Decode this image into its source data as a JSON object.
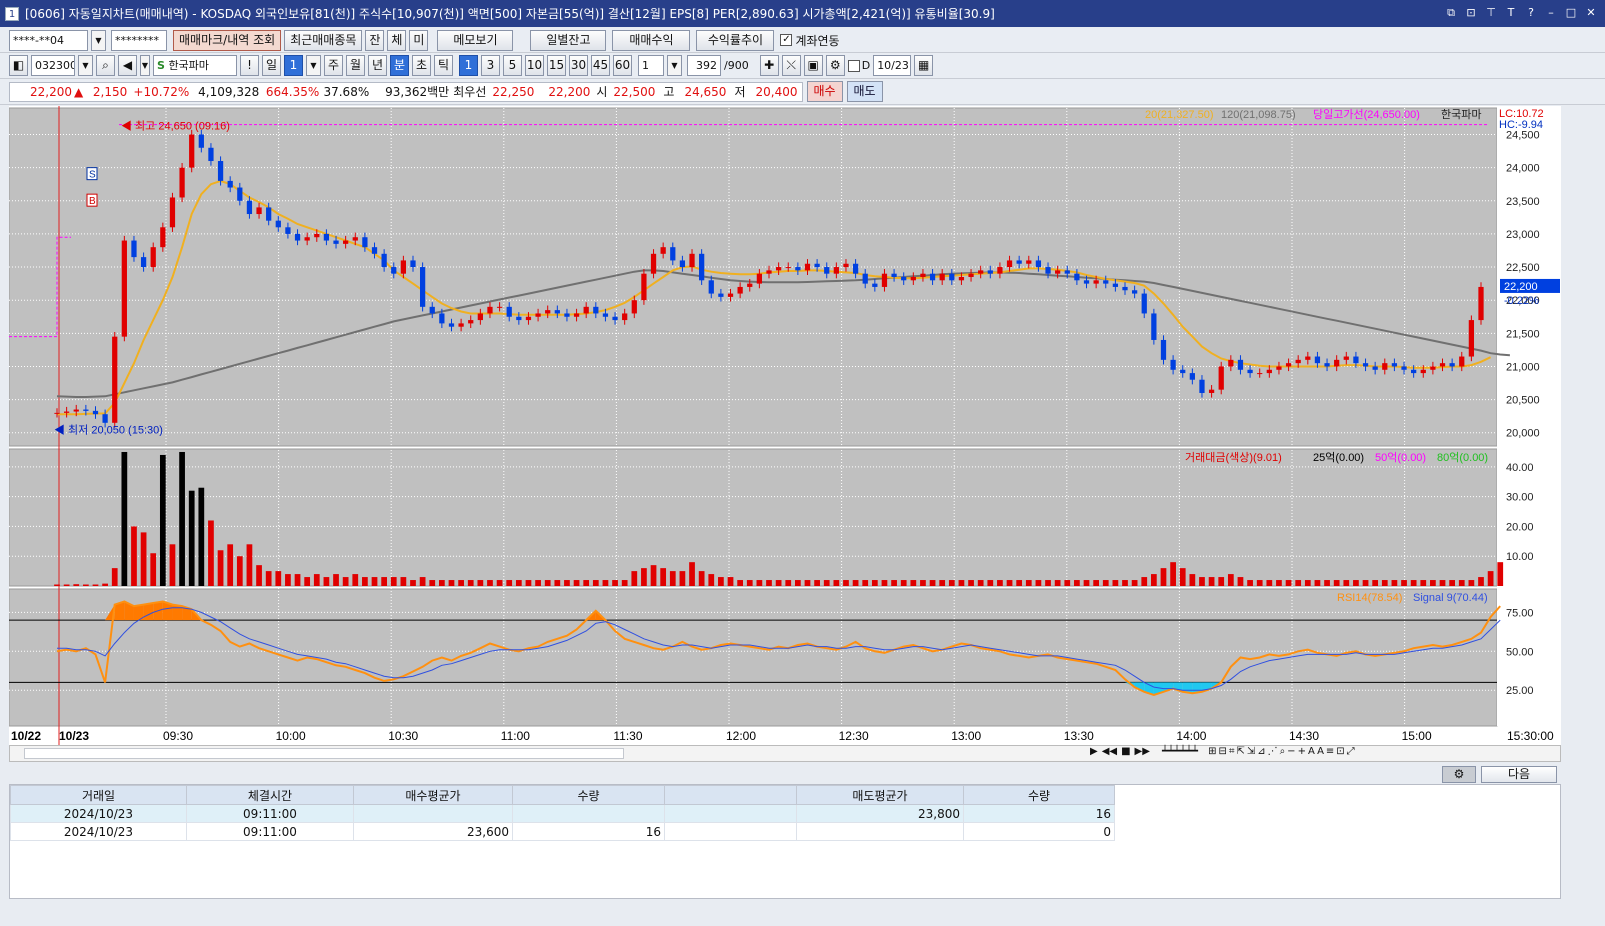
{
  "window": {
    "title": "[0606] 자동일지차트(매매내역) - KOSDAQ 외국인보유[81(천)] 주식수[10,907(천)] 액면[500] 자본금[55(억)] 결산[12월] EPS[8] PER[2,890.63] 시가총액[2,421(억)] 유통비율[30.9]",
    "icon_label": "1"
  },
  "toolbar1": {
    "account": "****-**04",
    "password": "********",
    "btn_trade_mark": "매매마크/내역 조회",
    "btn_recent": "최근매매종목",
    "btn_jan": "잔",
    "btn_che": "체",
    "btn_mi": "미",
    "btn_memo": "메모보기",
    "btn_daily_balance": "일별잔고",
    "btn_profit": "매매수익",
    "btn_yield": "수익률추이",
    "chk_link": "계좌연동"
  },
  "toolbar2": {
    "code": "032300",
    "stock_name": "한국파마",
    "exclaim": "!",
    "period_day": "일",
    "period_num": "1",
    "week": "주",
    "month": "월",
    "year": "년",
    "minute": "분",
    "second": "초",
    "tick": "틱",
    "intervals": [
      "1",
      "3",
      "5",
      "10",
      "15",
      "30",
      "45",
      "60"
    ],
    "interval_input": "1",
    "count": "392",
    "count_max": "/900",
    "d_label": "D",
    "date": "10/23"
  },
  "pricebar": {
    "price": "22,200",
    "arrow": "▲",
    "change": "2,150",
    "change_pct": "+10.72%",
    "volume": "4,109,328",
    "vol_ratio": "664.35%",
    "turnover": "37.68%",
    "amount": "93,362백만",
    "best_ask_label": "최우선",
    "ask": "22,250",
    "bid": "22,200",
    "open_label": "시",
    "open": "22,500",
    "high_label": "고",
    "high": "24,650",
    "low_label": "저",
    "low": "20,400",
    "buy": "매수",
    "sell": "매도"
  },
  "chart_data": {
    "type": "candlestick",
    "stock": "한국파마",
    "x_ticks": [
      "10/22",
      "10/23",
      "09:30",
      "10:00",
      "10:30",
      "11:00",
      "11:30",
      "12:00",
      "12:30",
      "13:00",
      "13:30",
      "14:00",
      "14:30",
      "15:00",
      "15:30:00"
    ],
    "price_axis": [
      "24,500",
      "24,000",
      "23,500",
      "23,000",
      "22,500",
      "22,000",
      "21,500",
      "21,000",
      "20,500",
      "20,000"
    ],
    "ylim": [
      19800,
      24900
    ],
    "legend": {
      "ma20": "20(21,327.50)",
      "ma120": "120(21,098.75)",
      "high_line": "당일고가선(24,650.00)",
      "name": "한국파마",
      "lc": "LC:10.72",
      "hc": "HC:-9.94"
    },
    "current_price": "22,200",
    "current_pct": "-0.22%",
    "annotations": {
      "high": "최고 24,650 (09:16)",
      "low": "최저 20,050 (15:30)",
      "sell_mark": "S",
      "buy_mark": "B"
    },
    "high_value": 24650,
    "low_value": 20050,
    "prev_close_level": 21450,
    "closes": [
      20300,
      20320,
      20350,
      20330,
      20280,
      20150,
      21450,
      22900,
      22650,
      22500,
      22800,
      23100,
      23550,
      24000,
      24500,
      24300,
      24100,
      23800,
      23700,
      23500,
      23300,
      23400,
      23200,
      23100,
      23000,
      22900,
      22950,
      23000,
      22900,
      22850,
      22900,
      22950,
      22800,
      22700,
      22500,
      22400,
      22600,
      22500,
      21900,
      21800,
      21650,
      21600,
      21650,
      21700,
      21800,
      21900,
      21900,
      21750,
      21700,
      21750,
      21800,
      21850,
      21800,
      21750,
      21800,
      21900,
      21800,
      21750,
      21700,
      21800,
      22000,
      22400,
      22700,
      22800,
      22600,
      22500,
      22700,
      22300,
      22100,
      22050,
      22100,
      22200,
      22250,
      22400,
      22450,
      22500,
      22500,
      22450,
      22550,
      22500,
      22400,
      22500,
      22550,
      22400,
      22250,
      22200,
      22400,
      22350,
      22300,
      22350,
      22400,
      22300,
      22400,
      22300,
      22350,
      22400,
      22450,
      22400,
      22500,
      22600,
      22550,
      22600,
      22500,
      22400,
      22450,
      22400,
      22300,
      22250,
      22300,
      22250,
      22200,
      22150,
      22100,
      21800,
      21400,
      21100,
      20950,
      20900,
      20800,
      20600,
      20650,
      21000,
      21100,
      20950,
      20900,
      20900,
      20950,
      21000,
      21050,
      21100,
      21150,
      21050,
      21000,
      21100,
      21150,
      21050,
      21000,
      20950,
      21050,
      21000,
      20950,
      20900,
      20950,
      21000,
      21050,
      21000,
      21150,
      21700,
      22200
    ],
    "ma20": [
      20280,
      20280,
      20280,
      20285,
      20290,
      20290,
      20450,
      20750,
      21050,
      21400,
      21700,
      22000,
      22350,
      22800,
      23300,
      23600,
      23750,
      23800,
      23750,
      23650,
      23550,
      23480,
      23400,
      23300,
      23230,
      23150,
      23100,
      23050,
      23000,
      22950,
      22900,
      22850,
      22800,
      22700,
      22600,
      22450,
      22350,
      22250,
      22150,
      22050,
      21950,
      21880,
      21830,
      21800,
      21800,
      21800,
      21800,
      21790,
      21780,
      21780,
      21780,
      21780,
      21780,
      21780,
      21790,
      21800,
      21820,
      21850,
      21900,
      21960,
      22050,
      22150,
      22250,
      22350,
      22450,
      22500,
      22510,
      22460,
      22430,
      22410,
      22400,
      22390,
      22390,
      22400,
      22420,
      22430,
      22440,
      22440,
      22450,
      22450,
      22440,
      22430,
      22420,
      22410,
      22380,
      22360,
      22350,
      22340,
      22330,
      22330,
      22340,
      22350,
      22360,
      22370,
      22380,
      22390,
      22400,
      22410,
      22420,
      22440,
      22460,
      22480,
      22480,
      22470,
      22460,
      22440,
      22420,
      22380,
      22350,
      22320,
      22300,
      22280,
      22260,
      22220,
      22100,
      21950,
      21780,
      21600,
      21450,
      21300,
      21200,
      21120,
      21080,
      21050,
      21030,
      21010,
      21000,
      21000,
      21000,
      21000,
      21000,
      21000,
      21000,
      21010,
      21020,
      21020,
      21010,
      21000,
      21000,
      21000,
      20990,
      20980,
      20980,
      20980,
      20990,
      21000,
      21000,
      21020,
      21070,
      21140
    ],
    "ma120": [
      20550,
      20545,
      20540,
      20540,
      20545,
      20550,
      20580,
      20610,
      20640,
      20670,
      20700,
      20730,
      20760,
      20800,
      20840,
      20880,
      20920,
      20960,
      21000,
      21040,
      21080,
      21120,
      21160,
      21200,
      21240,
      21280,
      21320,
      21360,
      21400,
      21440,
      21480,
      21520,
      21560,
      21600,
      21640,
      21680,
      21710,
      21740,
      21770,
      21800,
      21830,
      21860,
      21890,
      21920,
      21950,
      21980,
      22010,
      22040,
      22070,
      22100,
      22130,
      22160,
      22190,
      22220,
      22250,
      22280,
      22310,
      22340,
      22370,
      22400,
      22430,
      22450,
      22450,
      22440,
      22420,
      22400,
      22380,
      22360,
      22340,
      22320,
      22300,
      22290,
      22280,
      22275,
      22270,
      22270,
      22270,
      22270,
      22275,
      22280,
      22285,
      22290,
      22295,
      22300,
      22310,
      22320,
      22330,
      22340,
      22350,
      22360,
      22370,
      22380,
      22390,
      22400,
      22405,
      22410,
      22415,
      22420,
      22420,
      22415,
      22410,
      22400,
      22390,
      22380,
      22370,
      22360,
      22350,
      22340,
      22330,
      22320,
      22310,
      22300,
      22290,
      22280,
      22260,
      22230,
      22200,
      22170,
      22140,
      22110,
      22080,
      22050,
      22020,
      21990,
      21960,
      21930,
      21900,
      21870,
      21840,
      21810,
      21780,
      21750,
      21720,
      21690,
      21660,
      21630,
      21600,
      21570,
      21540,
      21510,
      21480,
      21450,
      21420,
      21390,
      21360,
      21330,
      21300,
      21270,
      21240,
      21200,
      21180,
      21170
    ],
    "volume_legend": {
      "label": "거래대금(색상)(9.01)",
      "l1": "25억(0.00)",
      "l2": "50억(0.00)",
      "l3": "80억(0.00)"
    },
    "volume_axis": [
      "40.00",
      "30.00",
      "20.00",
      "10.00"
    ],
    "volume_ylim": [
      0,
      46
    ],
    "volume": [
      0.5,
      0.5,
      0.6,
      0.5,
      0.5,
      0.8,
      6,
      45,
      20,
      18,
      11,
      44,
      14,
      45,
      32,
      33,
      22,
      12,
      14,
      10,
      14,
      7,
      5,
      5,
      4,
      4,
      3,
      4,
      3,
      4,
      3,
      4,
      3,
      3,
      3,
      3,
      3,
      2,
      3,
      2,
      2,
      2,
      2,
      2,
      2,
      2,
      2,
      2,
      2,
      2,
      2,
      2,
      2,
      2,
      2,
      2,
      2,
      2,
      2,
      2,
      5,
      6,
      7,
      6,
      5,
      5,
      8,
      5,
      4,
      3,
      3,
      2,
      2,
      2,
      2,
      2,
      2,
      2,
      2,
      2,
      2,
      2,
      2,
      2,
      2,
      2,
      2,
      2,
      2,
      2,
      2,
      2,
      2,
      2,
      2,
      2,
      2,
      2,
      2,
      2,
      2,
      2,
      2,
      2,
      2,
      2,
      2,
      2,
      2,
      2,
      2,
      2,
      2,
      3,
      4,
      6,
      8,
      6,
      4,
      3,
      3,
      3,
      4,
      3,
      2,
      2,
      2,
      2,
      2,
      2,
      2,
      2,
      2,
      2,
      2,
      2,
      2,
      2,
      2,
      2,
      2,
      2,
      2,
      2,
      2,
      2,
      2,
      2,
      3,
      5,
      8
    ],
    "rsi_legend": {
      "rsi": "RSI14(78.54)",
      "signal": "Signal 9(70.44)"
    },
    "rsi_axis": [
      "75.00",
      "50.00",
      "25.00"
    ],
    "rsi_ylim": [
      2,
      90
    ],
    "rsi_levels": [
      70,
      30
    ],
    "rsi": [
      50,
      51,
      50,
      52,
      48,
      30,
      80,
      82,
      79,
      80,
      81,
      82,
      80,
      79,
      77,
      70,
      67,
      63,
      56,
      53,
      55,
      52,
      50,
      48,
      46,
      44,
      46,
      45,
      43,
      41,
      40,
      38,
      36,
      33,
      31,
      32,
      34,
      37,
      40,
      44,
      46,
      44,
      47,
      49,
      52,
      55,
      53,
      51,
      50,
      52,
      53,
      56,
      58,
      60,
      64,
      70,
      76,
      70,
      63,
      58,
      56,
      54,
      52,
      51,
      53,
      56,
      53,
      51,
      52,
      54,
      55,
      54,
      53,
      52,
      51,
      53,
      52,
      54,
      55,
      53,
      52,
      51,
      53,
      56,
      52,
      50,
      49,
      51,
      53,
      54,
      52,
      50,
      51,
      53,
      55,
      54,
      52,
      51,
      50,
      48,
      47,
      46,
      47,
      48,
      46,
      45,
      44,
      43,
      42,
      40,
      38,
      32,
      27,
      24,
      22,
      24,
      26,
      24,
      23,
      24,
      26,
      30,
      40,
      46,
      45,
      46,
      48,
      47,
      48,
      50,
      51,
      49,
      48,
      47,
      49,
      50,
      48,
      47,
      48,
      49,
      50,
      52,
      53,
      54,
      53,
      54,
      56,
      58,
      62,
      72,
      79
    ],
    "signal": [
      52,
      52,
      51,
      51,
      50,
      47,
      55,
      62,
      68,
      72,
      75,
      77,
      78,
      78,
      77,
      75,
      72,
      69,
      65,
      61,
      58,
      56,
      54,
      52,
      50,
      48,
      47,
      46,
      45,
      43,
      42,
      40,
      38,
      36,
      34,
      33,
      33,
      34,
      36,
      38,
      41,
      42,
      44,
      46,
      48,
      50,
      51,
      51,
      51,
      51,
      52,
      53,
      55,
      57,
      60,
      63,
      68,
      69,
      67,
      64,
      61,
      58,
      56,
      54,
      53,
      54,
      54,
      53,
      52,
      53,
      54,
      54,
      54,
      53,
      52,
      52,
      52,
      53,
      54,
      53,
      53,
      52,
      52,
      53,
      53,
      52,
      51,
      51,
      52,
      53,
      53,
      52,
      51,
      52,
      53,
      54,
      53,
      52,
      51,
      50,
      49,
      48,
      47,
      47,
      47,
      46,
      45,
      44,
      43,
      42,
      41,
      38,
      34,
      30,
      27,
      26,
      26,
      25,
      25,
      25,
      26,
      28,
      32,
      37,
      40,
      42,
      44,
      45,
      46,
      47,
      48,
      48,
      48,
      48,
      48,
      49,
      48,
      48,
      48,
      48,
      49,
      50,
      51,
      52,
      52,
      53,
      54,
      56,
      58,
      64,
      70
    ]
  },
  "table": {
    "headers": [
      "거래일",
      "체결시간",
      "매수평균가",
      "수량",
      "",
      "매도평균가",
      "수량"
    ],
    "rows": [
      [
        "2024/10/23",
        "09:11:00",
        "",
        "",
        "",
        "23,800",
        "16"
      ],
      [
        "2024/10/23",
        "09:11:00",
        "23,600",
        "16",
        "",
        "",
        "0"
      ]
    ],
    "next_button": "다음"
  }
}
